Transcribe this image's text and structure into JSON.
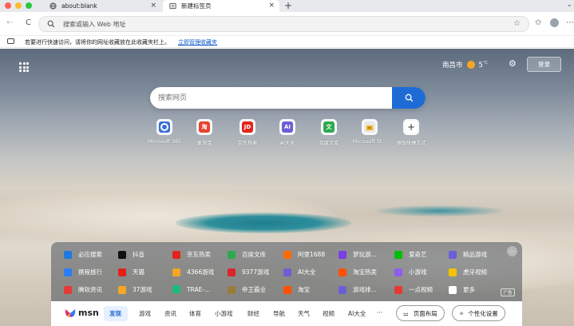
{
  "tabs": [
    {
      "label": "about:blank",
      "close": "×"
    },
    {
      "label": "新建标签页",
      "close": "×"
    }
  ],
  "new_tab_symbol": "+",
  "tab_menu_symbol": "⌄",
  "address": {
    "placeholder": "搜索或输入 Web 地址"
  },
  "bookmark_bar": {
    "hint": "若要进行快速访问，请将你的网址收藏放在此收藏夹栏上。",
    "link": "立即管理收藏夹"
  },
  "header": {
    "city": "南昌市",
    "temperature": "5",
    "temp_unit": "°C",
    "login_label": "登录"
  },
  "search": {
    "placeholder": "搜索网页"
  },
  "quick_links": [
    {
      "label": "Microsoft 365",
      "glyph": "",
      "color": "#3b6fd8"
    },
    {
      "label": "爱淘宝",
      "glyph": "淘",
      "color": "#e8432f"
    },
    {
      "label": "京东热卖",
      "glyph": "JD",
      "color": "#e1251b"
    },
    {
      "label": "AI大全",
      "glyph": "AI",
      "color": "#6b5fd6"
    },
    {
      "label": "百度文库",
      "glyph": "文",
      "color": "#2eaa4e"
    },
    {
      "label": "Microsoft St...",
      "glyph": "",
      "color": "#e7e7e7"
    },
    {
      "label": "添加快捷方式",
      "glyph": "+",
      "color": "#ffffff"
    }
  ],
  "links_rows": [
    [
      {
        "label": "必应搜索",
        "color": "#1f7ae0"
      },
      {
        "label": "抖音",
        "color": "#111111"
      },
      {
        "label": "京东热卖",
        "color": "#e1251b"
      },
      {
        "label": "百度文库",
        "color": "#2eaa4e"
      },
      {
        "label": "阿里1688",
        "color": "#ff6a00"
      },
      {
        "label": "梦玩游...",
        "color": "#7b3fe4"
      },
      {
        "label": "爱奇艺",
        "color": "#00be06"
      },
      {
        "label": "精品游戏",
        "color": "#6b5fd6"
      }
    ],
    [
      {
        "label": "携程旅行",
        "color": "#2d7cf6"
      },
      {
        "label": "天猫",
        "color": "#e0221a"
      },
      {
        "label": "4366游戏",
        "color": "#f5a623"
      },
      {
        "label": "9377游戏",
        "color": "#d9262b"
      },
      {
        "label": "AI大全",
        "color": "#6b5fd6"
      },
      {
        "label": "淘宝热卖",
        "color": "#ff5000"
      },
      {
        "label": "小游戏",
        "color": "#8e5cf0"
      },
      {
        "label": "虎牙视频",
        "color": "#f5c200"
      }
    ],
    [
      {
        "label": "腾软资讯",
        "color": "#e53935"
      },
      {
        "label": "37游戏",
        "color": "#f5a623"
      },
      {
        "label": "TRAE-...",
        "color": "#1fba7a"
      },
      {
        "label": "帝王霸业",
        "color": "#9b7b3a"
      },
      {
        "label": "淘宝",
        "color": "#ff5000"
      },
      {
        "label": "游戏排...",
        "color": "#6b5fd6"
      },
      {
        "label": "一点视频",
        "color": "#e53935"
      },
      {
        "label": "更多",
        "color": "#ffffff"
      }
    ]
  ],
  "panel": {
    "more_symbol": "···",
    "ad_label": "广告"
  },
  "msn": {
    "logo": "msn",
    "nav": [
      "发现",
      "游戏",
      "资讯",
      "体育",
      "小游戏",
      "财经",
      "导航",
      "天气",
      "视频",
      "AI大全"
    ],
    "overflow": "···",
    "layout_label": "页面布局",
    "personalize_label": "个性化设置"
  },
  "colors": {
    "accent": "#1e6bd6",
    "link": "#0a58ca"
  }
}
